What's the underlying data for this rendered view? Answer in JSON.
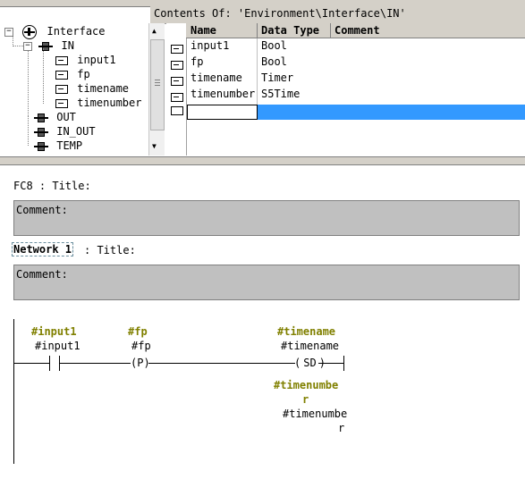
{
  "window": {
    "path_label": "Contents Of: 'Environment\\Interface\\IN'"
  },
  "tree": {
    "root": "Interface",
    "in": "IN",
    "in_children": [
      "input1",
      "fp",
      "timename",
      "timenumber"
    ],
    "out": "OUT",
    "in_out": "IN_OUT",
    "temp": "TEMP"
  },
  "table": {
    "headers": {
      "name": "Name",
      "type": "Data Type",
      "comment": "Comment"
    },
    "rows": [
      {
        "name": "input1",
        "type": "Bool"
      },
      {
        "name": "fp",
        "type": "Bool"
      },
      {
        "name": "timename",
        "type": "Timer"
      },
      {
        "name": "timenumber",
        "type": "S5Time"
      }
    ]
  },
  "block": {
    "title": "FC8 : Title:",
    "comment_label": "Comment:",
    "network_label": "Network 1",
    "network_title": ": Title:",
    "network_comment_label": "Comment:"
  },
  "ladder": {
    "contact1_operand": "#input1",
    "contact1_tag": "#input1",
    "edge_operand": "#fp",
    "edge_tag": "#fp",
    "edge_symbol": "P",
    "coil_operand": "#timename",
    "coil_tag": "#timename",
    "coil_symbol": "SD",
    "time_operand_line1": "#timenumbe",
    "time_operand_line2": "r",
    "time_tag_line1": "#timenumbe",
    "time_tag_line2": "r"
  }
}
